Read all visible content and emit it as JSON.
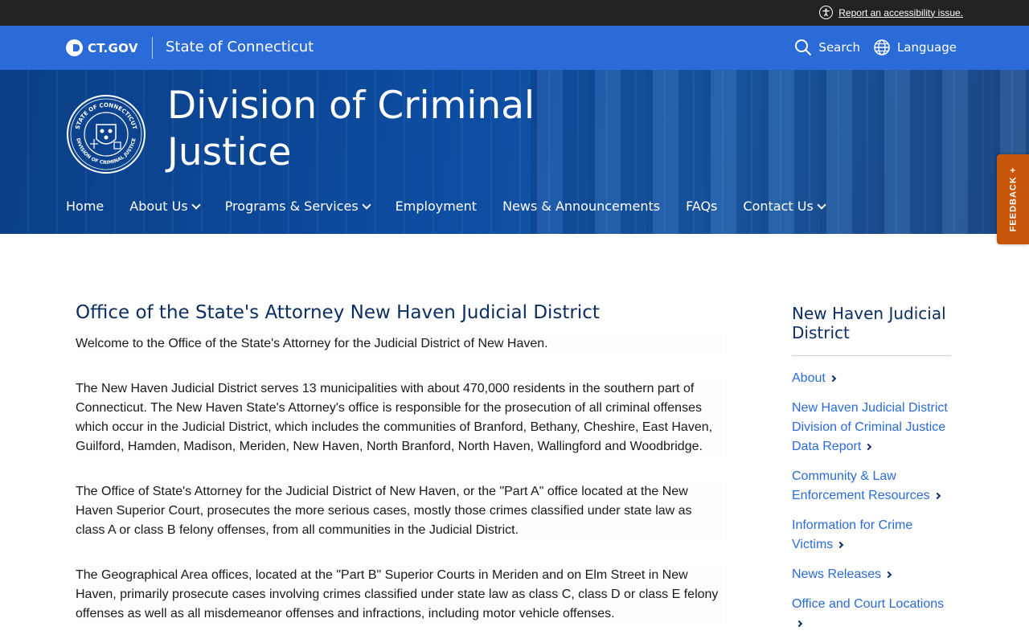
{
  "utility": {
    "accessibility_link": "Report an accessibility issue."
  },
  "ctgov": {
    "logo_text": "CT.GOV",
    "state_name": "State of Connecticut",
    "search_label": "Search",
    "language_label": "Language"
  },
  "hero": {
    "title": "Division of Criminal Justice",
    "seal_top_text": "STATE OF CONNECTICUT",
    "seal_bottom_text": "DIVISION OF CRIMINAL JUSTICE"
  },
  "nav": {
    "items": [
      {
        "label": "Home",
        "dropdown": false
      },
      {
        "label": "About Us",
        "dropdown": true
      },
      {
        "label": "Programs & Services",
        "dropdown": true
      },
      {
        "label": "Employment",
        "dropdown": false
      },
      {
        "label": "News & Announcements",
        "dropdown": false
      },
      {
        "label": "FAQs",
        "dropdown": false
      },
      {
        "label": "Contact Us",
        "dropdown": true
      }
    ]
  },
  "feedback": {
    "label": "FEEDBACK +"
  },
  "main": {
    "title": "Office of the State's Attorney New Haven Judicial District",
    "paragraphs": [
      "Welcome to the Office of the State's Attorney for the Judicial District of New Haven.",
      "The New Haven Judicial District serves 13 municipalities with about 470,000 residents in the southern part of Connecticut. The New Haven State's Attorney's office is responsible for the prosecution of all criminal offenses which occur in the Judicial District, which includes the communities of Branford, Bethany, Cheshire, East Haven, Guilford, Hamden, Madison, Meriden, New Haven, North Branford, North Haven, Wallingford and Woodbridge.",
      "The Office of State's Attorney for the Judicial District of New Haven, or the \"Part A\" office located at the New Haven Superior Court, prosecutes the more serious cases, mostly those crimes classified under state law as class A or class B felony offenses, from all communities in the Judicial District.",
      "The Geographical Area offices, located at the \"Part B\" Superior Courts in Meriden and on Elm Street in New Haven, primarily prosecute cases involving crimes classified under state law as class C, class D or class E felony offenses as well as all misdemeanor offenses and infractions, including motor vehicle offenses."
    ]
  },
  "sidebar": {
    "title": "New Haven Judicial District",
    "links": [
      "About",
      "New Haven Judicial District Division of Criminal Justice Data Report",
      "Community & Law Enforcement Resources",
      "Information for Crime Victims",
      "News Releases",
      "Office and Court Locations"
    ]
  },
  "colors": {
    "ct_blue": "#2b6bd8",
    "navy": "#0b2e63",
    "feedback_orange": "#c8560b",
    "topbar": "#222222"
  }
}
